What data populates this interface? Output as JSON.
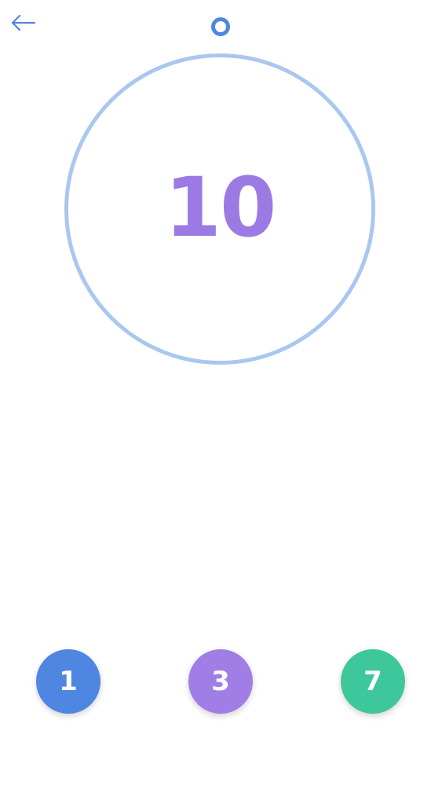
{
  "header": {
    "back_icon": "arrow-left-icon",
    "indicator_icon": "ring-dot-icon"
  },
  "target": {
    "value": "10"
  },
  "options": [
    {
      "label": "1",
      "color": "#4f86e2"
    },
    {
      "label": "3",
      "color": "#a07ee6"
    },
    {
      "label": "7",
      "color": "#3ec79b"
    }
  ],
  "colors": {
    "accent_blue": "#4f86e2",
    "circle_outline": "#a9c7f0",
    "target_purple": "#9b7ae4",
    "option_green": "#3ec79b"
  }
}
